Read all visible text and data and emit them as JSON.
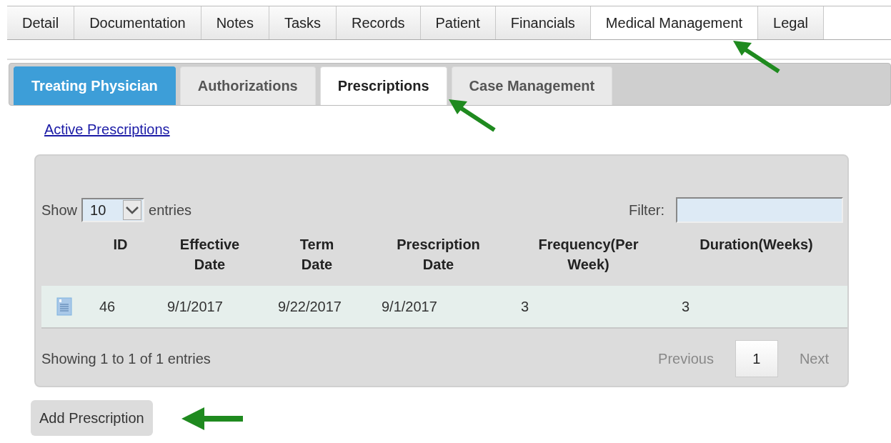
{
  "main_tabs": [
    {
      "label": "Detail",
      "selected": false
    },
    {
      "label": "Documentation",
      "selected": false
    },
    {
      "label": "Notes",
      "selected": false
    },
    {
      "label": "Tasks",
      "selected": false
    },
    {
      "label": "Records",
      "selected": false
    },
    {
      "label": "Patient",
      "selected": false
    },
    {
      "label": "Financials",
      "selected": false
    },
    {
      "label": "Medical Management",
      "selected": true
    },
    {
      "label": "Legal",
      "selected": false
    }
  ],
  "sub_tabs": [
    {
      "label": "Treating Physician",
      "selected": false,
      "active": true
    },
    {
      "label": "Authorizations",
      "selected": false,
      "active": false
    },
    {
      "label": "Prescriptions",
      "selected": true,
      "active": false
    },
    {
      "label": "Case Management",
      "selected": false,
      "active": false
    }
  ],
  "section_link": "Active Prescriptions",
  "table": {
    "show_label": "Show",
    "page_size": "10",
    "entries_label": "entries",
    "filter_label": "Filter:",
    "columns": [
      "ID",
      "Effective Date",
      "Term Date",
      "Prescription Date",
      "Frequency(Per Week)",
      "Duration(Weeks)"
    ],
    "rows": [
      {
        "cells": [
          "46",
          "9/1/2017",
          "9/22/2017",
          "9/1/2017",
          "3",
          "3"
        ]
      }
    ],
    "info": "Showing 1 to 1 of 1 entries",
    "previous": {
      "label": "Previous",
      "disabled": true
    },
    "pages": [
      {
        "label": "1",
        "selected": true
      }
    ],
    "next": {
      "label": "Next",
      "disabled": true
    }
  },
  "add_button": "Add Prescription"
}
